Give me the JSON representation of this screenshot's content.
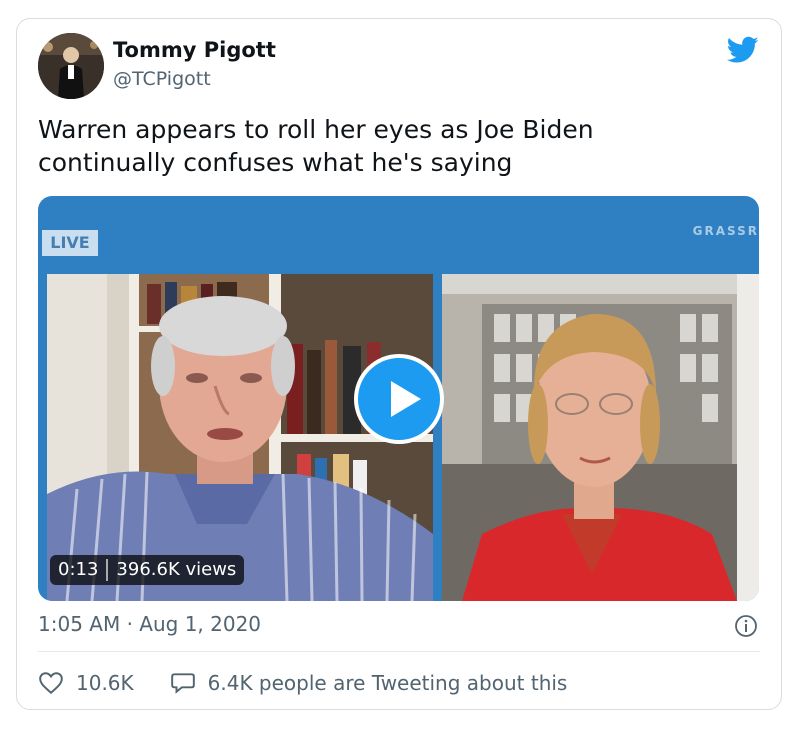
{
  "tweet": {
    "author_name": "Tommy Pigott",
    "author_handle": "@TCPigott",
    "text": "Warren appears to roll her eyes as Joe Biden continually confuses what he's saying",
    "timestamp": "1:05 AM · Aug 1, 2020",
    "likes": "10.6K",
    "conversation_text": "6.4K people are Tweeting about this",
    "brand_color": "#1d9bf0"
  },
  "video": {
    "live_label": "LIVE",
    "watermark": "GRASSR",
    "duration": "0:13",
    "views": "396.6K views"
  },
  "icons": {
    "brand": "twitter-bird-icon",
    "play": "play-icon",
    "info": "info-icon",
    "like": "heart-icon",
    "reply": "speech-bubble-icon"
  }
}
